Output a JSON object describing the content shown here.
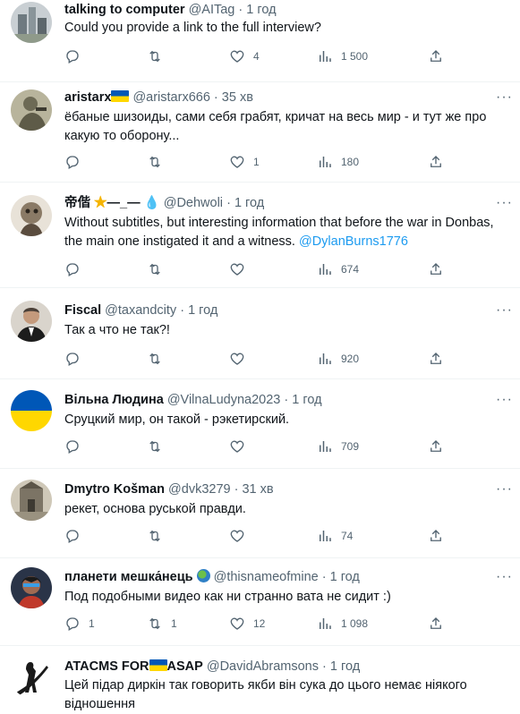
{
  "tweets": [
    {
      "name": "talking to computer",
      "handle": "@AITag",
      "sep": "·",
      "time": "1 год",
      "text": "Could you provide a link to the full interview?",
      "mention": "",
      "reply": "",
      "retweet": "",
      "like": "4",
      "views": "1 500"
    },
    {
      "name": "aristarx",
      "handle": "@aristarx666",
      "sep": "·",
      "time": "35 хв",
      "text": "ёбаные шизоиды, сами себя грабят, кричат на весь мир  - и тут же про какую то оборону...",
      "mention": "",
      "reply": "",
      "retweet": "",
      "like": "1",
      "views": "180"
    },
    {
      "name": "帝偕",
      "name_suffix": "—_—",
      "handle": "@Dehwoli",
      "sep": "·",
      "time": "1 год",
      "text": "Without subtitles, but interesting information that before the war in Donbas, the main one instigated it and a witness. ",
      "mention": "@DylanBurns1776",
      "reply": "",
      "retweet": "",
      "like": "",
      "views": "674"
    },
    {
      "name": "Fiscal",
      "handle": "@taxandcity",
      "sep": "·",
      "time": "1 год",
      "text": "Так а что не так?!",
      "mention": "",
      "reply": "",
      "retweet": "",
      "like": "",
      "views": "920"
    },
    {
      "name": "Вільна Людина",
      "handle": "@VilnaLudyna2023",
      "sep": "·",
      "time": "1 год",
      "text": "Сруцкий мир, он такой - рэкетирский.",
      "mention": "",
      "reply": "",
      "retweet": "",
      "like": "",
      "views": "709"
    },
    {
      "name": "Dmytro Košman",
      "handle": "@dvk3279",
      "sep": "·",
      "time": "31 хв",
      "text": "рекет, основа руськой правди.",
      "mention": "",
      "reply": "",
      "retweet": "",
      "like": "",
      "views": "74"
    },
    {
      "name": "планети мешка́нець",
      "handle": "@thisnameofmine",
      "sep": "·",
      "time": "1 год",
      "text": "Под подобными видео как ни странно вата не сидит :)",
      "mention": "",
      "reply": "1",
      "retweet": "1",
      "like": "12",
      "views": "1 098"
    },
    {
      "name": "ATACMS FOR",
      "name_suffix": "ASAP",
      "handle": "@DavidAbramsons",
      "sep": "·",
      "time": "1 год",
      "text": "Цей підар диркін так говорить якби він сука до цього немає ніякого відношення",
      "mention": "",
      "reply": "",
      "retweet": "",
      "like": "",
      "views": ""
    }
  ],
  "icons": {
    "reply": "reply-icon",
    "retweet": "retweet-icon",
    "like": "heart-icon",
    "views": "views-icon",
    "share": "share-icon",
    "more": "more-icon"
  },
  "colors": {
    "text": "#0f1419",
    "secondary": "#536471",
    "link": "#1d9bf0",
    "divider": "#eff3f4"
  }
}
